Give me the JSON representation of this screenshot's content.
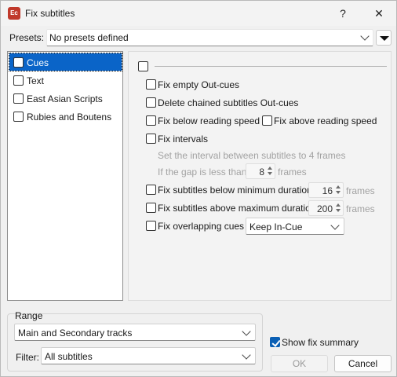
{
  "window": {
    "title": "Fix subtitles",
    "app_icon_text": "Ec",
    "help_label": "?",
    "close_label": "✕"
  },
  "presets": {
    "label": "Presets:",
    "selected": "No presets defined"
  },
  "categories": [
    {
      "label": "Cues",
      "checked": false,
      "selected": true
    },
    {
      "label": "Text",
      "checked": false,
      "selected": false
    },
    {
      "label": "East Asian Scripts",
      "checked": false,
      "selected": false
    },
    {
      "label": "Rubies and Boutens",
      "checked": false,
      "selected": false
    }
  ],
  "cues": {
    "fix_empty_out_cues": "Fix empty Out-cues",
    "delete_chained_out_cues": "Delete chained subtitles Out-cues",
    "fix_below_reading_speed": "Fix below reading speed",
    "fix_above_reading_speed": "Fix above reading speed",
    "fix_intervals": "Fix intervals",
    "interval_text": "Set the interval between subtitles to 4 frames",
    "gap_text": "If the gap is less than",
    "gap_value": "8",
    "gap_unit": "frames",
    "fix_below_min_duration": "Fix subtitles below minimum duration",
    "min_duration_value": "16",
    "min_duration_unit": "frames",
    "fix_above_max_duration": "Fix subtitles above maximum duration",
    "max_duration_value": "200",
    "max_duration_unit": "frames",
    "fix_overlapping": "Fix overlapping cues",
    "overlap_mode": "Keep In-Cue"
  },
  "range": {
    "label": "Range",
    "tracks": "Main and Secondary tracks",
    "filter_label": "Filter:",
    "filter_value": "All subtitles"
  },
  "footer": {
    "show_summary_label": "Show fix summary",
    "show_summary_checked": true,
    "ok_label": "OK",
    "cancel_label": "Cancel"
  }
}
